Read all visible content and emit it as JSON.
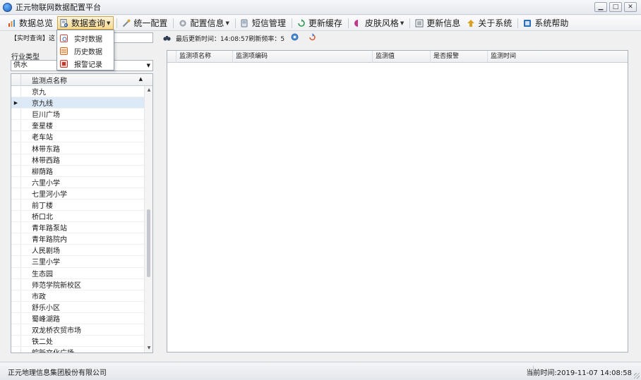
{
  "window": {
    "title": "正元物联网数据配置平台",
    "controls": [
      "minimize",
      "maximize",
      "close"
    ]
  },
  "menu": {
    "items": [
      {
        "label": "数据总览",
        "icon": "chart-icon",
        "color": "#d84c2a",
        "dropdown": false
      },
      {
        "label": "数据查询",
        "icon": "document-search-icon",
        "color": "#5a6c86",
        "dropdown": true,
        "active": true
      },
      {
        "label": "统一配置",
        "icon": "tools-icon",
        "color": "#d9a43a",
        "dropdown": false
      },
      {
        "label": "配置信息",
        "icon": "settings-icon",
        "color": "#8a8f99",
        "dropdown": true
      },
      {
        "label": "短信管理",
        "icon": "sms-icon",
        "color": "#6a7a90",
        "dropdown": false
      },
      {
        "label": "更新缓存",
        "icon": "cache-refresh-icon",
        "color": "#2f9a4e",
        "dropdown": false
      },
      {
        "label": "皮肤风格",
        "icon": "skin-icon",
        "color": "#c03a8c",
        "dropdown": true
      },
      {
        "label": "更新信息",
        "icon": "update-info-icon",
        "color": "#5b6575",
        "dropdown": false
      },
      {
        "label": "关于系统",
        "icon": "about-icon",
        "color": "#d8a21f",
        "dropdown": false
      },
      {
        "label": "系统帮助",
        "icon": "help-icon",
        "color": "#2b6fb8",
        "dropdown": false
      }
    ]
  },
  "dropdown": {
    "items": [
      {
        "label": "实时数据",
        "icon": "realtime-data-icon",
        "color": "#d0443a"
      },
      {
        "label": "历史数据",
        "icon": "history-data-icon",
        "color": "#cf6b2a"
      },
      {
        "label": "报警记录",
        "icon": "alarm-record-icon",
        "color": "#c0392b"
      }
    ]
  },
  "query": {
    "label": "【实时查询】这",
    "input_value": "",
    "last_update": "最后更新时间：14:08:57刷新频率：5"
  },
  "left": {
    "industry_label": "行业类型",
    "industry_value": "供水",
    "column_header": "监测点名称",
    "selected_index": 1,
    "rows": [
      "京九",
      "京九线",
      "巨川广场",
      "奎星楼",
      "老车站",
      "林带东路",
      "林带西路",
      "柳荫路",
      "六里小学",
      "七里河小学",
      "前丁楼",
      "桥口北",
      "青年路泵站",
      "青年路院内",
      "人民剧场",
      "三里小学",
      "生态园",
      "师范学院新校区",
      "市政",
      "舒乐小区",
      "蜀峰湖路",
      "双龙桥农贸市场",
      "铁二处",
      "皖新文化广场"
    ]
  },
  "right": {
    "columns": [
      "监测项名称",
      "监测项编码",
      "监测值",
      "是否报警",
      "监测时间"
    ]
  },
  "status": {
    "company": "正元地理信息集团股份有限公司",
    "current_time": "当前时间:2019-11-07 14:08:58"
  }
}
